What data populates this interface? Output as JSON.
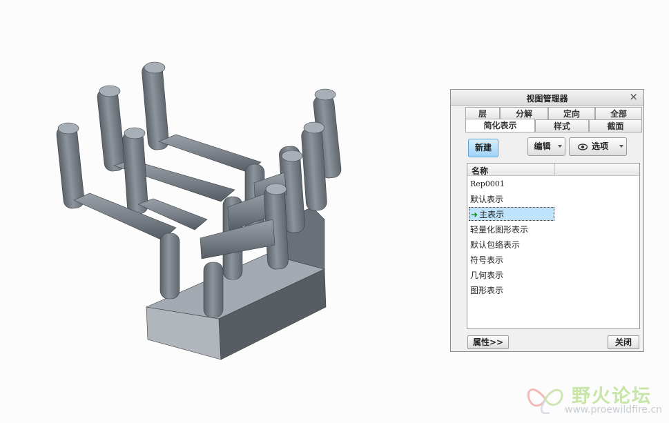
{
  "panel": {
    "title": "视图管理器",
    "close_symbol": "×",
    "collapse_symbol": "«",
    "tabs_row1": [
      "层",
      "分解",
      "定向",
      "全部"
    ],
    "tabs_row2": [
      "简化表示",
      "样式",
      "截面"
    ],
    "active_tab": "简化表示",
    "buttons": {
      "new": "新建",
      "edit": "编辑",
      "options": "选项"
    },
    "list_header": "名称",
    "items": [
      "Rep0001",
      "默认表示",
      "主表示",
      "轻量化图形表示",
      "默认包络表示",
      "符号表示",
      "几何表示",
      "图形表示"
    ],
    "selected_item": "主表示",
    "footer": {
      "properties": "属性>>",
      "close": "关闭"
    }
  },
  "watermark": {
    "text": "野火论坛",
    "url": "www.proewildfire.cn",
    "icon": "butterfly-logo-icon"
  },
  "icons": {
    "options": "eye-icon",
    "current": "green-arrow-icon",
    "dropdown": "chevron-down-icon"
  }
}
